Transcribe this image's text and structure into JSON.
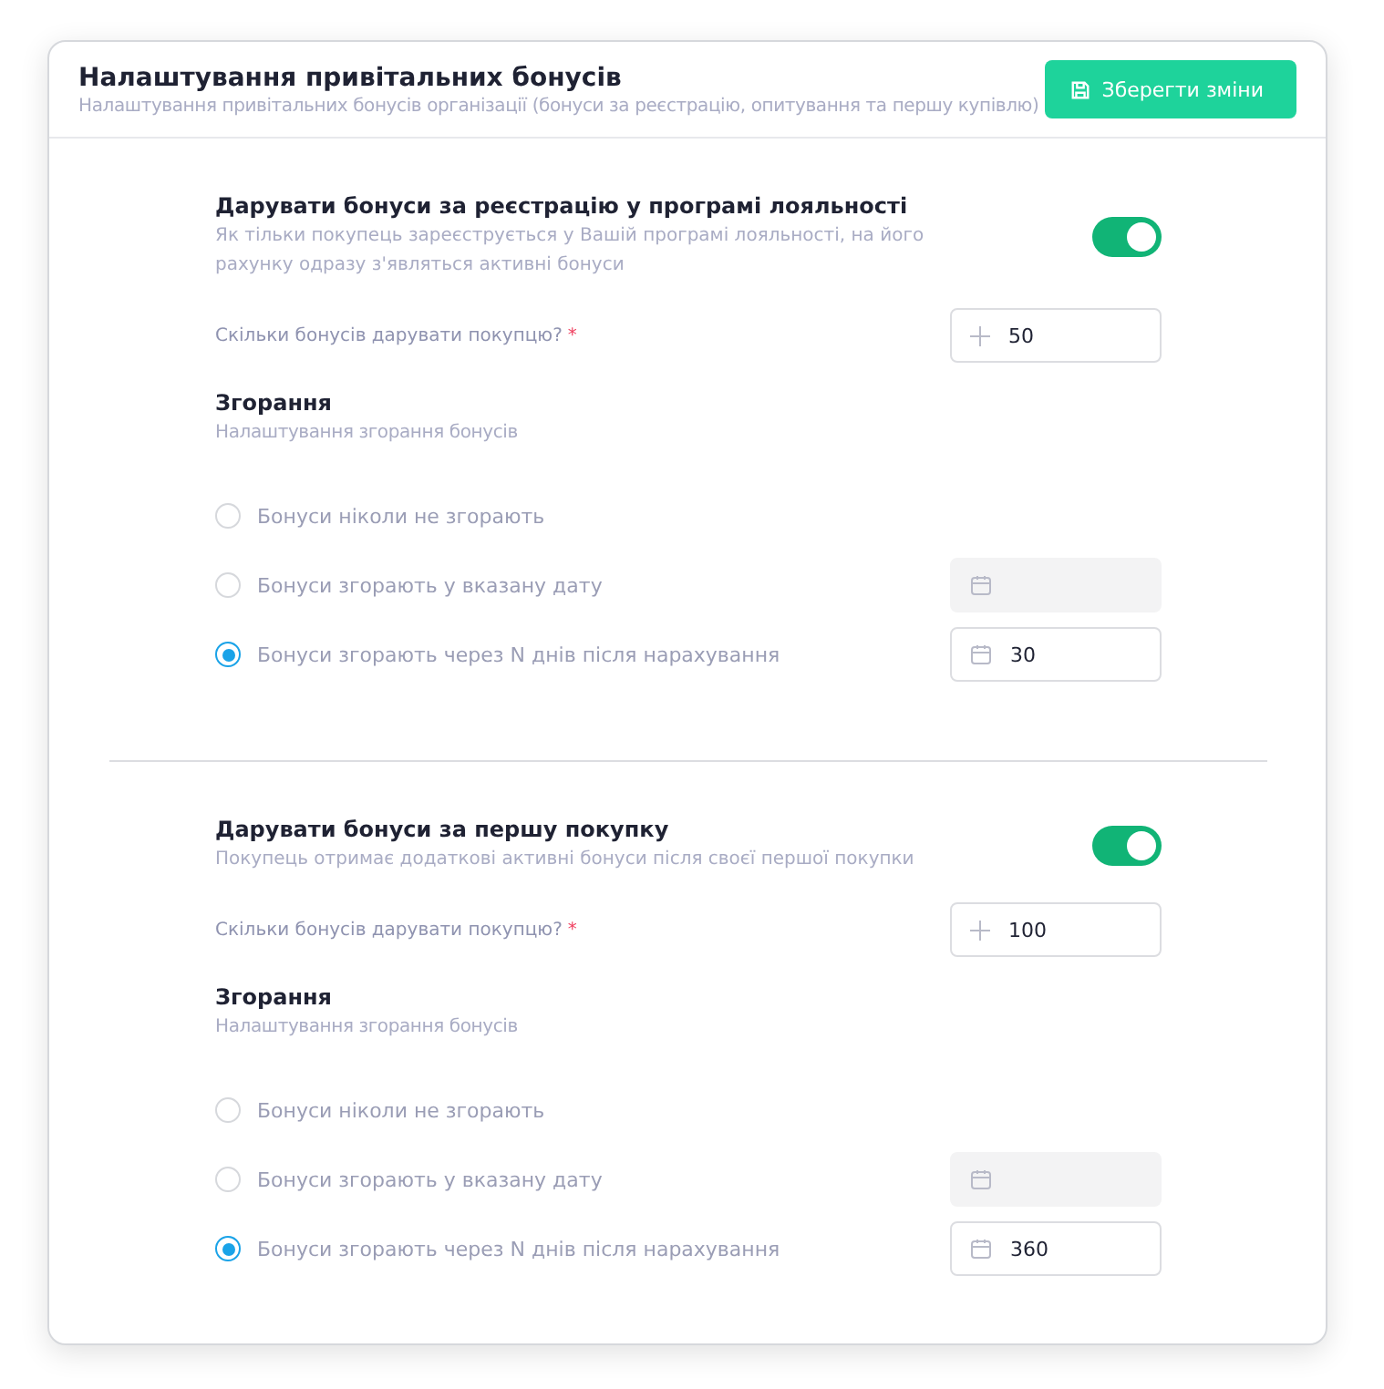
{
  "header": {
    "title": "Налаштування привітальних бонусів",
    "subtitle": "Налаштування привітальних бонусів організації (бонуси за реєстрацію, опитування та першу купівлю)",
    "save_button": "Зберегти зміни"
  },
  "sections": [
    {
      "title": "Дарувати бонуси за реєстрацію у програмі лояльності",
      "description": "Як тільки покупець зареєструється у Вашій програмі лояльності, на його рахунку одразу з'являться активні бонуси",
      "on": true,
      "amount": {
        "label": "Скільки бонусів дарувати покупцю?",
        "required_mark": "*",
        "value": "50"
      },
      "expiry": {
        "title": "Згорання",
        "subtitle": "Налаштування згорання бонусів",
        "options": [
          {
            "label": "Бонуси ніколи не згорають",
            "selected": false,
            "kind": "plain"
          },
          {
            "label": "Бонуси згорають у вказану дату",
            "selected": false,
            "kind": "field",
            "field": {
              "disabled": true
            }
          },
          {
            "label": "Бонуси згорають через N днів після нарахування",
            "selected": true,
            "kind": "field",
            "field": {
              "disabled": false,
              "value": "30"
            }
          }
        ]
      }
    },
    {
      "title": "Дарувати бонуси за першу покупку",
      "description": "Покупець отримає додаткові активні бонуси після своєї першої покупки",
      "on": true,
      "amount": {
        "label": "Скільки бонусів дарувати покупцю?",
        "required_mark": "*",
        "value": "100"
      },
      "expiry": {
        "title": "Згорання",
        "subtitle": "Налаштування згорання бонусів",
        "options": [
          {
            "label": "Бонуси ніколи не згорають",
            "selected": false,
            "kind": "plain"
          },
          {
            "label": "Бонуси згорають у вказану дату",
            "selected": false,
            "kind": "field",
            "field": {
              "disabled": true
            }
          },
          {
            "label": "Бонуси згорають через N днів після нарахування",
            "selected": true,
            "kind": "field",
            "field": {
              "disabled": false,
              "value": "360"
            }
          }
        ]
      }
    }
  ]
}
